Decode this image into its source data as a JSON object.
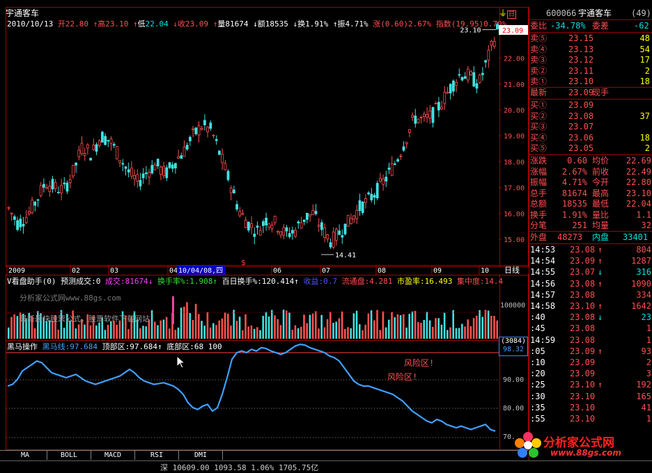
{
  "stock": {
    "name": "宇通客车",
    "code": "600066",
    "rank": "(49)"
  },
  "header": {
    "date": "2010/10/13",
    "open_label": "开",
    "open": "22.80",
    "high_label": "高",
    "high": "23.10",
    "low_label": "低",
    "low": "22.04",
    "close_label": "收",
    "close": "23.09",
    "vol_label": "量",
    "vol": "81674",
    "amt_label": "额",
    "amt": "18535",
    "turn_label": "换",
    "turn": "1.91%",
    "amp_label": "振",
    "amp": "4.71%",
    "chg_text": "涨(0.60)2.67%",
    "idx_text": "指数(19.95)0.70%"
  },
  "price_axis": {
    "ticks": [
      "22.00",
      "21.00",
      "20.00",
      "19.00",
      "18.00",
      "17.00",
      "16.00",
      "15.00"
    ],
    "current": "23.09"
  },
  "annotations": {
    "high_mark": "23.10",
    "low_mark": "14.41"
  },
  "date_axis": {
    "labels": [
      "2009",
      "02",
      "03",
      "04",
      "06",
      "07",
      "08",
      "09",
      "10"
    ],
    "cursor_date": "10/04/08,四",
    "period_label": "日线"
  },
  "volume_panel": {
    "title": "V看盘助手(0)",
    "fields": [
      {
        "label": "预测成交:",
        "value": "0",
        "color": "#ffffff"
      },
      {
        "label": "成交:",
        "value": "81674",
        "color": "#ff40ff",
        "arrow": "↓"
      },
      {
        "label": "换手率%:",
        "value": "1.908",
        "color": "#30e030",
        "arrow": "↑"
      },
      {
        "label": "百日换手%:",
        "value": "120.414",
        "color": "#ffffff",
        "arrow": "↑"
      },
      {
        "label": "收益:",
        "value": "0.7",
        "color": "#5050ff"
      },
      {
        "label": "流通盘:",
        "value": "4.281",
        "color": "#ff5050"
      },
      {
        "label": "市盈率:",
        "value": "16.493",
        "color": "#ffff00"
      },
      {
        "label": "集中度:",
        "value": "14.4",
        "color": "#ff5050"
      }
    ],
    "axis_label": "100000",
    "watermark1": "分析家公式网www.88gs.com",
    "watermark2": "最新最快股票公式，股票软件下载网站"
  },
  "indicator_panel": {
    "title": "黑马操作",
    "fields": [
      {
        "label": "黑马线:",
        "value": "97.684",
        "color": "#40a0ff"
      },
      {
        "label": "顶部区:",
        "value": "97.684",
        "color": "#ffffff",
        "arrow": "↑"
      },
      {
        "label": "底部区:",
        "value": "68 100",
        "color": "#ffffff"
      }
    ],
    "risk_label": "风险区!",
    "axis_ticks": [
      "90.00",
      "80.00",
      "70."
    ],
    "axis_box_top": "(3084)",
    "axis_box_val": "98.32"
  },
  "tabs": [
    "MA",
    "BOLL",
    "MACD",
    "RSI",
    "DMI"
  ],
  "status": "深 10609.00 1093.58 1.06% 1705.75亿",
  "quote": {
    "weibi_label": "委比",
    "weibi": "-34.78%",
    "weicha_label": "委差",
    "weicha": "-62",
    "sells": [
      {
        "label": "卖⑤",
        "price": "23.15",
        "vol": "48"
      },
      {
        "label": "卖④",
        "price": "23.13",
        "vol": "54"
      },
      {
        "label": "卖③",
        "price": "23.12",
        "vol": "17"
      },
      {
        "label": "卖②",
        "price": "23.11",
        "vol": "2"
      },
      {
        "label": "卖①",
        "price": "23.10",
        "vol": "18"
      }
    ],
    "latest_label": "最新",
    "latest": "23.09",
    "xianshou_label": "现手",
    "buys": [
      {
        "label": "买①",
        "price": "23.09",
        "vol": ""
      },
      {
        "label": "买②",
        "price": "23.08",
        "vol": "37"
      },
      {
        "label": "买③",
        "price": "23.07",
        "vol": ""
      },
      {
        "label": "买④",
        "price": "23.06",
        "vol": "18"
      },
      {
        "label": "买⑤",
        "price": "23.05",
        "vol": "2"
      }
    ],
    "stats": [
      {
        "l1": "涨跌",
        "v1": "0.60",
        "l2": "均价",
        "v2": "22.69"
      },
      {
        "l1": "涨幅",
        "v1": "2.67%",
        "l2": "前收",
        "v2": "22.49"
      },
      {
        "l1": "振幅",
        "v1": "4.71%",
        "l2": "今开",
        "v2": "22.80"
      },
      {
        "l1": "总手",
        "v1": "81674",
        "l2": "最高",
        "v2": "23.10"
      },
      {
        "l1": "总额",
        "v1": "18535",
        "l2": "最低",
        "v2": "22.04"
      },
      {
        "l1": "换手",
        "v1": "1.91%",
        "l2": "量比",
        "v2": "1.1"
      },
      {
        "l1": "分笔",
        "v1": "251",
        "l2": "均量",
        "v2": "32"
      }
    ],
    "outer_label": "外盘",
    "outer": "48273",
    "inner_label": "内盘",
    "inner": "33401"
  },
  "ticks": [
    {
      "t": "14:53",
      "p": "23.08",
      "a": "↑",
      "v": "804"
    },
    {
      "t": "14:54",
      "p": "23.09",
      "a": "↑",
      "v": "1287"
    },
    {
      "t": "14:55",
      "p": "23.07",
      "a": "↓",
      "v": "316"
    },
    {
      "t": "14:56",
      "p": "23.08",
      "a": "↑",
      "v": "1090"
    },
    {
      "t": "14:57",
      "p": "23.08",
      "a": "",
      "v": "334"
    },
    {
      "t": "14:58",
      "p": "23.10",
      "a": "↑",
      "v": "1642"
    },
    {
      "t": ":40",
      "p": "23.08",
      "a": "↓",
      "v": "23"
    },
    {
      "t": ":45",
      "p": "23.08",
      "a": "",
      "v": "1"
    },
    {
      "t": "14:59",
      "p": "23.08",
      "a": "",
      "v": "1"
    },
    {
      "t": ":05",
      "p": "23.09",
      "a": "↑",
      "v": "93"
    },
    {
      "t": ":10",
      "p": "23.09",
      "a": "",
      "v": "2"
    },
    {
      "t": ":20",
      "p": "23.09",
      "a": "",
      "v": "3"
    },
    {
      "t": ":25",
      "p": "23.10",
      "a": "↑",
      "v": "192"
    },
    {
      "t": ":30",
      "p": "23.10",
      "a": "",
      "v": "165"
    },
    {
      "t": ":35",
      "p": "23.10",
      "a": "",
      "v": "41"
    },
    {
      "t": ":55",
      "p": "23.10",
      "a": "",
      "v": "1"
    }
  ],
  "logo": {
    "text": "分析家公式网",
    "url_text": "www.88gs.com"
  },
  "colors": {
    "up": "#ff5050",
    "down": "#00e0e0",
    "frame": "#a00000",
    "bg": "#000000"
  }
}
